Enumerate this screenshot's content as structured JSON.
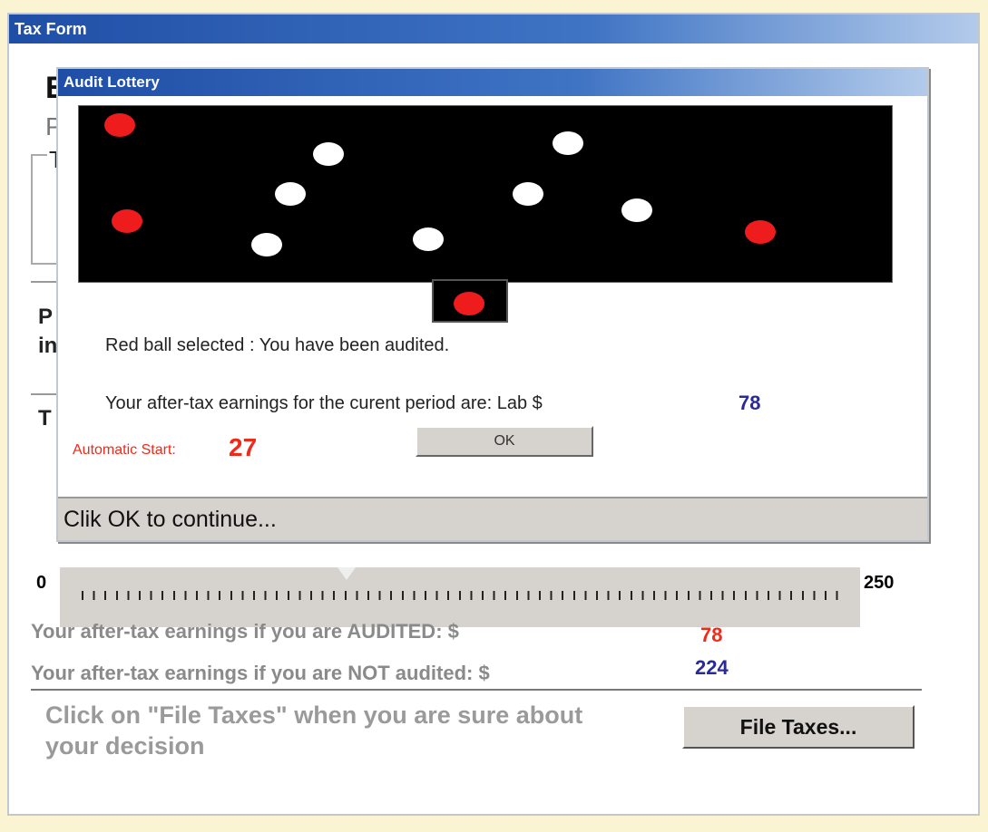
{
  "main_window": {
    "title": "Tax Form",
    "partial_heading": "E",
    "partial_subheading": "P",
    "partial_group": "T",
    "partial_label_p": "P",
    "partial_label_in": "in",
    "partial_label_t": "T",
    "slider": {
      "min_label": "0",
      "max_label": "250"
    },
    "audited_label": "Your after-tax earnings if you are AUDITED:  $",
    "audited_value": "78",
    "not_audited_label": "Your after-tax earnings if you are NOT audited:  $",
    "not_audited_value": "224",
    "instruction": "Click on \"File Taxes\" when you are sure about your decision",
    "file_button": "File Taxes..."
  },
  "dialog": {
    "title": "Audit Lottery",
    "result_text": "Red ball selected : You have been audited.",
    "earnings_text": "Your after-tax earnings for the curent period are:  Lab $",
    "earnings_value": "78",
    "auto_start_label": "Automatic Start:",
    "auto_start_value": "27",
    "ok_button": "OK",
    "status": "Clik OK to continue..."
  },
  "colors": {
    "red_ball": "#ee1c1c",
    "white_ball": "#ffffff",
    "accent_red": "#ee2a1a",
    "accent_blue": "#2a2a96"
  }
}
